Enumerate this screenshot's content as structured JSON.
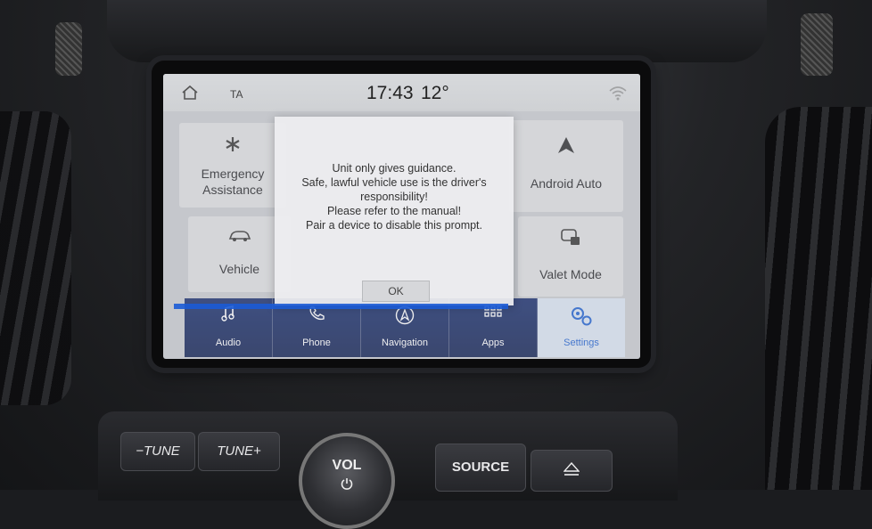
{
  "status_bar": {
    "ta": "TA",
    "time": "17:43",
    "temperature": "12°"
  },
  "tiles": {
    "emergency": {
      "label_line1": "Emergency",
      "label_line2": "Assistance",
      "icon": "emergency-icon"
    },
    "vehicle": {
      "label": "Vehicle",
      "icon": "car-icon"
    },
    "android_auto": {
      "label": "Android Auto",
      "icon": "android-auto-icon"
    },
    "valet_mode": {
      "label": "Valet Mode",
      "icon": "lock-icon"
    }
  },
  "dialog": {
    "line1": "Unit only gives guidance.",
    "line2": "Safe, lawful vehicle use is the driver's",
    "line3": "responsibility!",
    "line4": "Please refer to the manual!",
    "line5": "Pair a device to disable this prompt.",
    "ok_label": "OK"
  },
  "nav": [
    {
      "label": "Audio",
      "icon": "music-note-icon"
    },
    {
      "label": "Phone",
      "icon": "phone-icon"
    },
    {
      "label": "Navigation",
      "icon": "navigation-icon"
    },
    {
      "label": "Apps",
      "icon": "apps-grid-icon"
    },
    {
      "label": "Settings",
      "icon": "gears-icon",
      "active": true
    }
  ],
  "controls": {
    "tune_minus": "−TUNE",
    "tune_plus": "TUNE+",
    "vol": "VOL",
    "source": "SOURCE"
  },
  "colors": {
    "nav_background": "#142a6b",
    "active_tab": "#d9e3f2",
    "accent": "#1c5fd0"
  }
}
